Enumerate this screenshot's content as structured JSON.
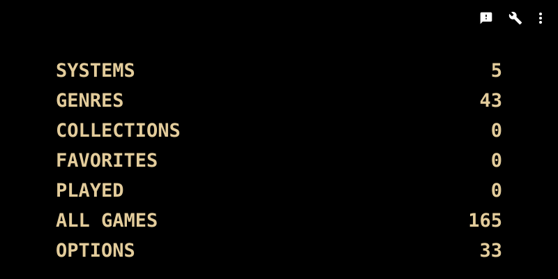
{
  "colors": {
    "background": "#000000",
    "text": "#E3CC9B",
    "icons": "#FFFFFF"
  },
  "toolbar": {
    "icons": [
      "feedback-icon",
      "wrench-icon",
      "more-vert-icon"
    ]
  },
  "menu": {
    "items": [
      {
        "label": "SYSTEMS",
        "count": "5"
      },
      {
        "label": "GENRES",
        "count": "43"
      },
      {
        "label": "COLLECTIONS",
        "count": "0"
      },
      {
        "label": "FAVORITES",
        "count": "0"
      },
      {
        "label": "PLAYED",
        "count": "0"
      },
      {
        "label": "ALL GAMES",
        "count": "165"
      },
      {
        "label": "OPTIONS",
        "count": "33"
      }
    ]
  }
}
